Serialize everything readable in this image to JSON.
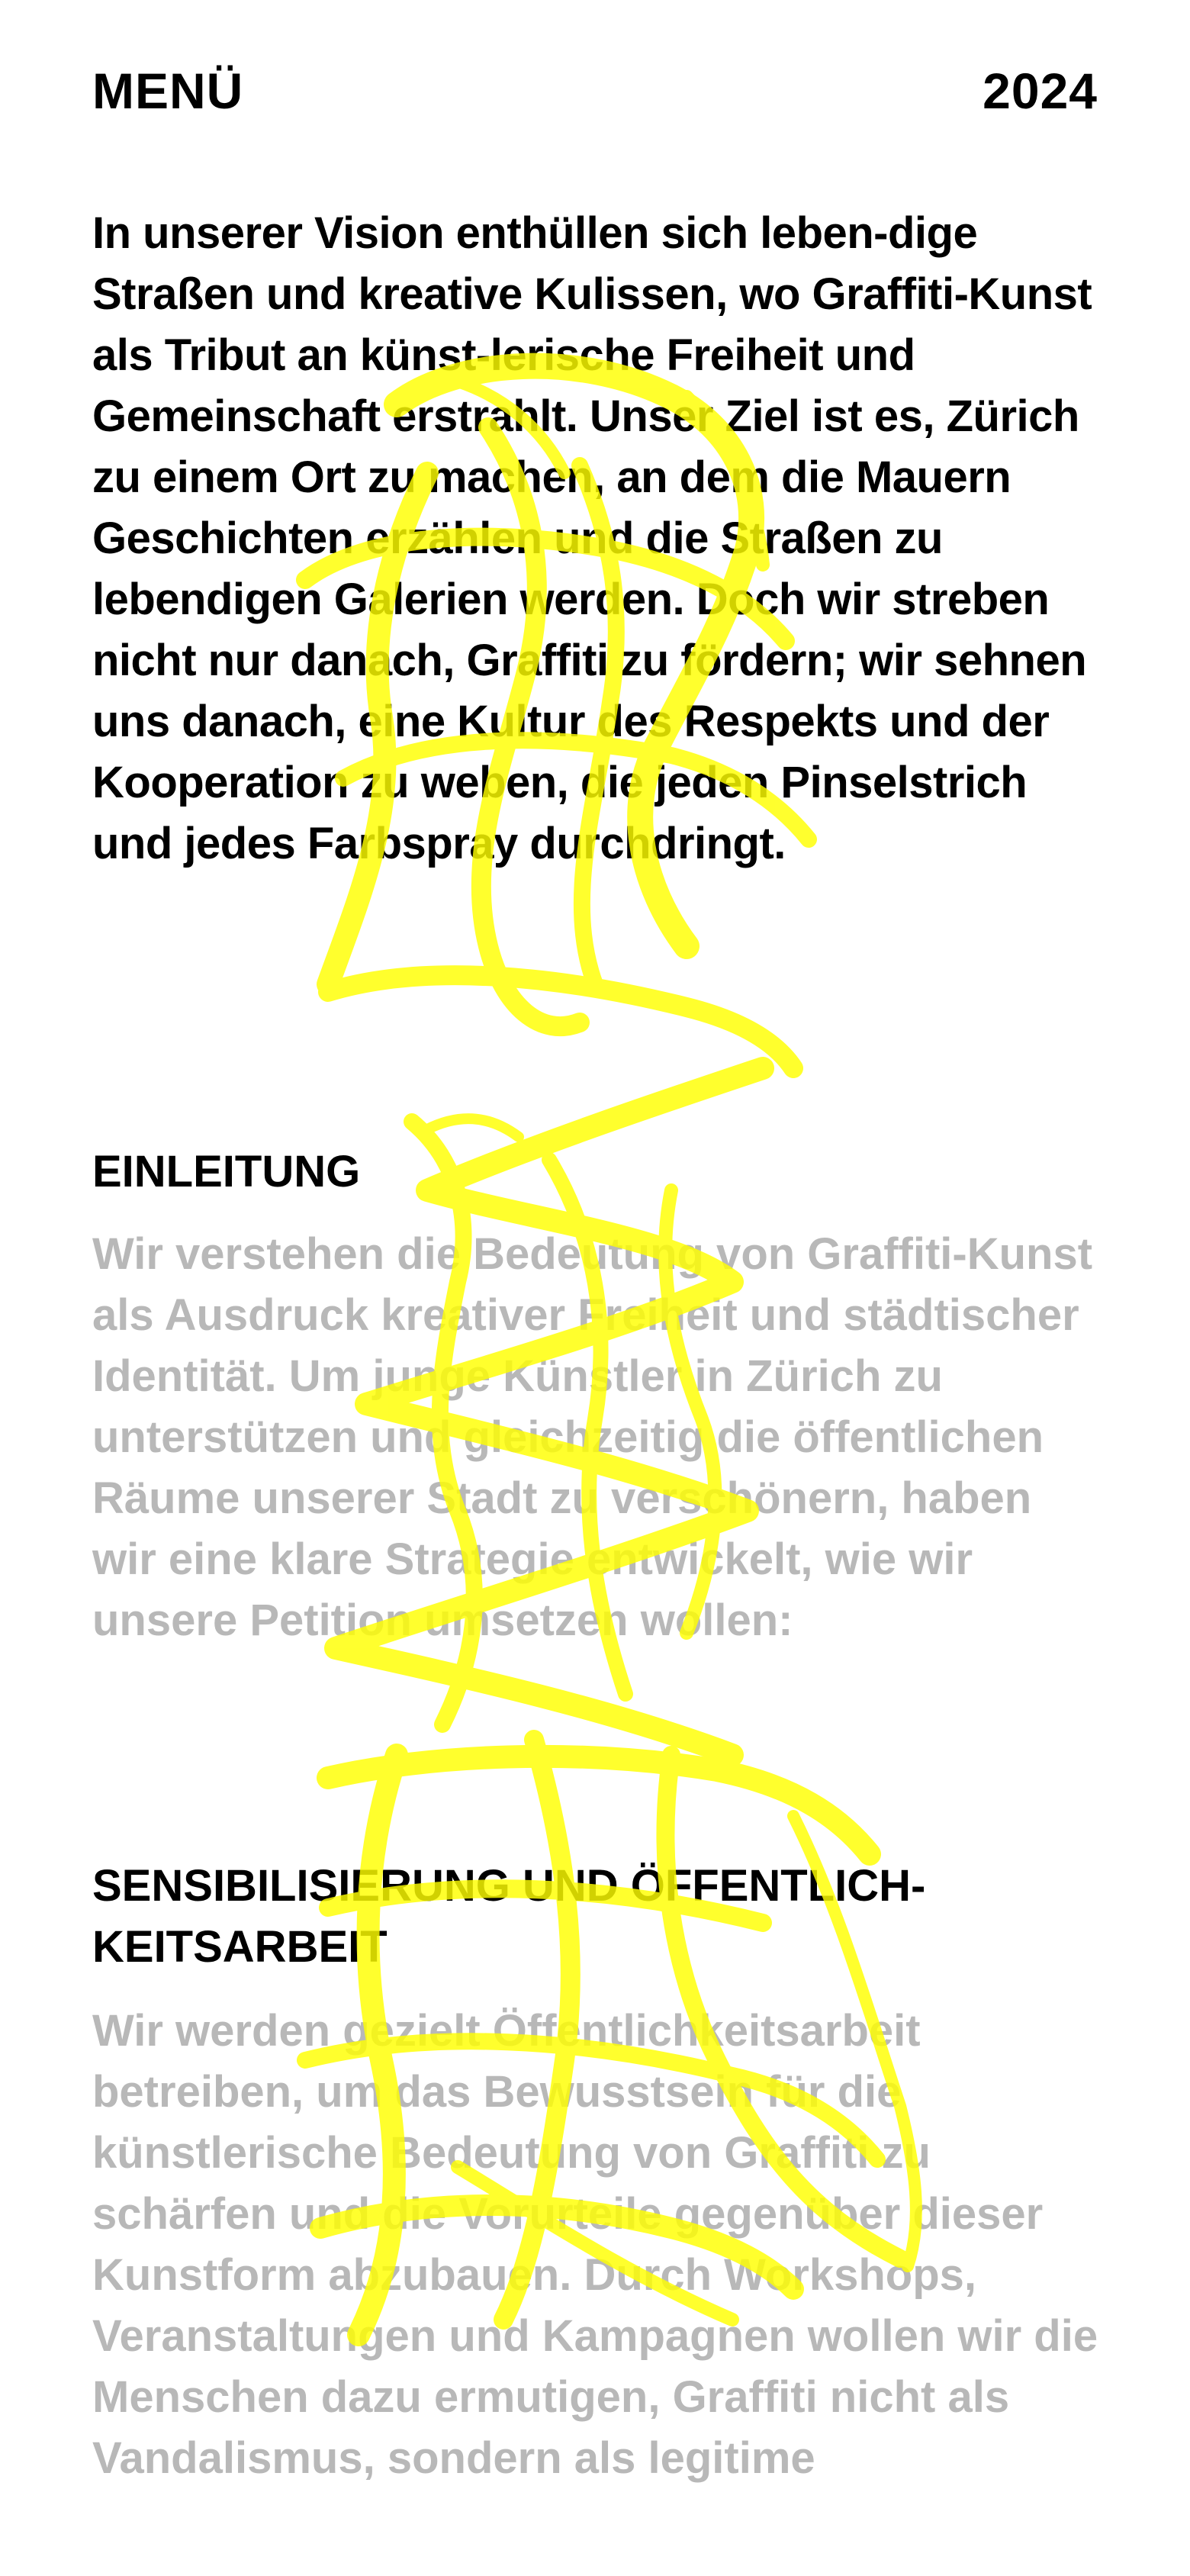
{
  "header": {
    "menu_label": "MENÜ",
    "year": "2024"
  },
  "intro": {
    "text": "In unserer Vision enthüllen sich leben-dige Straßen und kreative Kulissen, wo Graffiti-Kunst als Tribut an künst-lerische Freiheit und Gemeinschaft erstrahlt. Unser Ziel ist es, Zürich zu einem Ort zu machen, an dem die Mauern Geschichten erzählen und die Straßen zu lebendigen Galerien werden. Doch wir streben nicht nur danach, Graffiti zu fördern; wir sehnen uns danach, eine Kultur des Respekts und der Kooperation zu weben, die jeden Pinselstrich und jedes Farbspray durchdringt."
  },
  "sections": [
    {
      "title": "EINLEITUNG",
      "body": "Wir verstehen die Bedeutung von Graffiti-Kunst als Ausdruck kreativer Freiheit und städtischer Identität. Um junge Künstler in Zürich zu unterstützen und gleichzeitig die öffentlichen Räume unserer Stadt zu verschönern, haben wir eine klare Strategie entwickelt, wie wir unsere Petition umsetzen wollen:"
    },
    {
      "title": "SENSIBILISIERUNG UND ÖFFENTLICH-KEITSARBEIT",
      "body": "Wir werden gezielt Öffentlichkeitsarbeit betreiben, um das Bewusstsein für die künstlerische Bedeutung von Graffiti zu schärfen und die Vorurteile gegenüber dieser Kunstform abzubauen. Durch Workshops, Veranstaltungen und Kampagnen wollen wir die Menschen dazu ermutigen, Graffiti nicht als Vandalismus, sondern als legitime"
    }
  ],
  "colors": {
    "text": "#000000",
    "muted": "#b8b8b8",
    "tag": "#ffff00",
    "background": "#ffffff"
  },
  "overlay": {
    "icon": "graffiti-tag-icon"
  }
}
